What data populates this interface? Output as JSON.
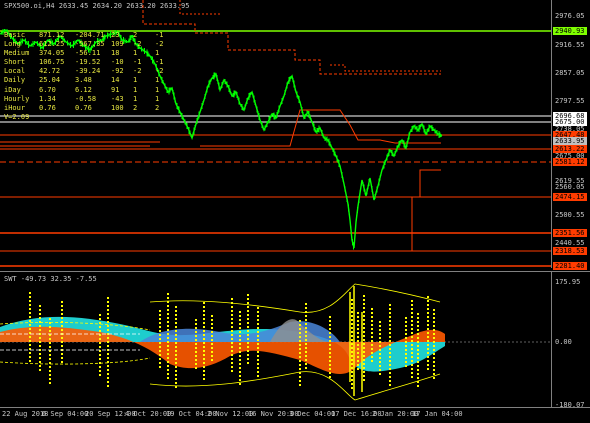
{
  "main_title": "SPX500.oi,H4  2633.45 2634.20 2633.20 2633.95",
  "sub_title": "SWT -49.73 32.35 -7.55",
  "legend_rows": [
    {
      "name": "Basic",
      "a": "871.12",
      "b": "-204.71",
      "c": "23",
      "d": "2",
      "e": "-1"
    },
    {
      "name": "Long",
      "a": "612.25",
      "b": "-567.35",
      "c": "109",
      "d": "-2",
      "e": "-2"
    },
    {
      "name": "Medium",
      "a": "374.05",
      "b": "-56.11",
      "c": "18",
      "d": "1",
      "e": "1"
    },
    {
      "name": "Short",
      "a": "106.75",
      "b": "-19.52",
      "c": "-10",
      "d": "-1",
      "e": "-1"
    },
    {
      "name": "Local",
      "a": "42.72",
      "b": "-39.24",
      "c": "-92",
      "d": "-2",
      "e": "-2"
    },
    {
      "name": "Daily",
      "a": "25.04",
      "b": "3.48",
      "c": "14",
      "d": "1",
      "e": "1"
    },
    {
      "name": "iDay",
      "a": "6.70",
      "b": "6.12",
      "c": "91",
      "d": "1",
      "e": "1"
    },
    {
      "name": "Hourly",
      "a": "1.34",
      "b": "-0.58",
      "c": "-43",
      "d": "1",
      "e": "1"
    },
    {
      "name": "iHour",
      "a": "0.76",
      "b": "0.76",
      "c": "100",
      "d": "2",
      "e": "2"
    }
  ],
  "legend_footer": "V=2.09",
  "main_yaxis_ticks": [
    "2976.05",
    "2916.55",
    "2857.05",
    "2797.55",
    "2738.05",
    "2675.00",
    "2619.55",
    "2560.05",
    "2500.55",
    "2440.55",
    "2381.05",
    "2321.05",
    "2261.55"
  ],
  "main_yaxis_tags": [
    {
      "text": "2940.93",
      "bg": "#7fff00",
      "fg": "#000000"
    },
    {
      "text": "2696.68",
      "bg": "#ffffff",
      "fg": "#000000"
    },
    {
      "text": "2675.00",
      "bg": "#ffffff",
      "fg": "#000000"
    },
    {
      "text": "2647.48",
      "bg": "#ff3c00",
      "fg": "#000000"
    },
    {
      "text": "2633.95",
      "bg": "#c0c0c0",
      "fg": "#000000"
    },
    {
      "text": "2613.22",
      "bg": "#ff3c00",
      "fg": "#000000"
    },
    {
      "text": "2581.12",
      "bg": "#ff3c00",
      "fg": "#000000"
    },
    {
      "text": "2474.15",
      "bg": "#ff3c00",
      "fg": "#000000"
    },
    {
      "text": "2351.56",
      "bg": "#ff3c00",
      "fg": "#000000"
    },
    {
      "text": "2318.53",
      "bg": "#ff3c00",
      "fg": "#000000"
    },
    {
      "text": "2281.40",
      "bg": "#ff3c00",
      "fg": "#000000"
    }
  ],
  "sub_yaxis_ticks": [
    "175.95",
    "0.00",
    "-180.07"
  ],
  "xaxis_ticks": [
    "22 Aug 2018",
    "6 Sep 04:00",
    "20 Sep 12:00",
    "4 Oct 20:00",
    "19 Oct 04:00",
    "2 Nov 12:00",
    "16 Nov 20:00",
    "3 Dec 04:00",
    "17 Dec 16:00",
    "2 Jan 20:00",
    "17 Jan 04:00"
  ],
  "colors": {
    "price": "#00ff00",
    "support": "#ff3c00",
    "resistance": "#7fff00",
    "level_white": "#ffffff",
    "osc_cyan": "#20d8d8",
    "osc_orange": "#ff5a00",
    "osc_blue": "#4a86d8",
    "osc_yellow": "#ffff00",
    "osc_gray": "#909090"
  }
}
